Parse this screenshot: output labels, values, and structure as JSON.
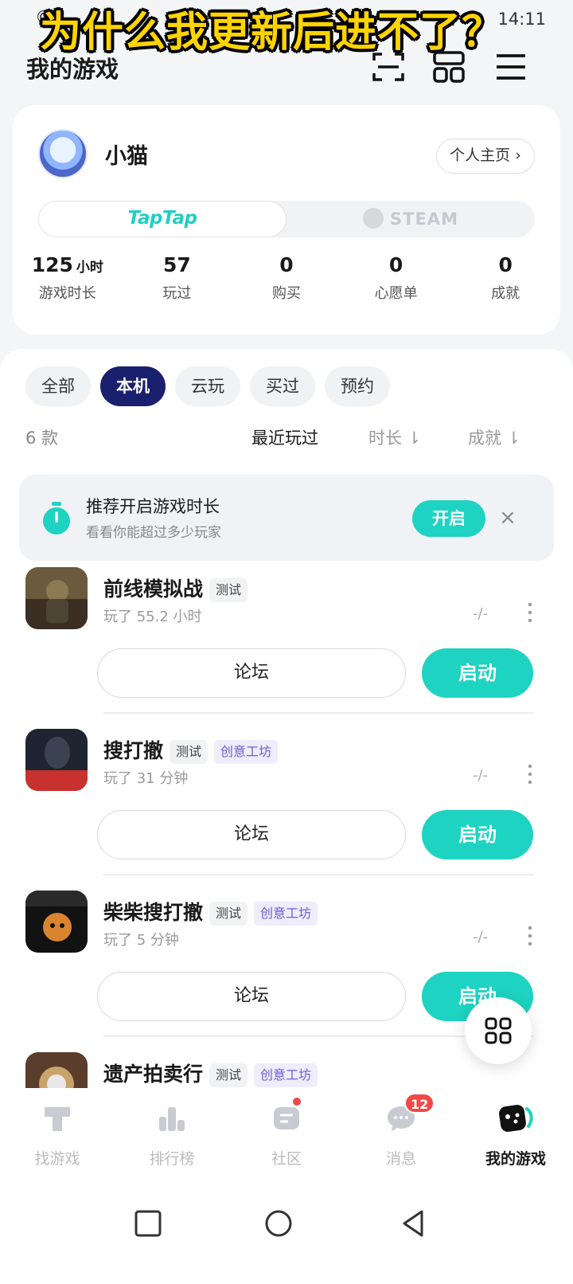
{
  "status_bar": {
    "left_icon": "©",
    "time": "14:11",
    "icons": "▮ ◢"
  },
  "overlay_caption": "为什么我更新后进不了？",
  "header": {
    "title": "我的游戏",
    "icons": [
      "scan-icon",
      "grid-icon",
      "menu-icon"
    ]
  },
  "profile": {
    "username": "小猫",
    "profile_button": "个人主页 ›",
    "platforms": {
      "active": "TapTap",
      "inactive": "STEAM"
    },
    "stats": [
      {
        "value": "125",
        "unit": "小时",
        "label": "游戏时长"
      },
      {
        "value": "57",
        "unit": "",
        "label": "玩过"
      },
      {
        "value": "0",
        "unit": "",
        "label": "购买"
      },
      {
        "value": "0",
        "unit": "",
        "label": "心愿单"
      },
      {
        "value": "0",
        "unit": "",
        "label": "成就"
      }
    ]
  },
  "filters": {
    "tabs": [
      "全部",
      "本机",
      "云玩",
      "买过",
      "预约"
    ],
    "active_tab": "本机",
    "count": "6 款",
    "sort": {
      "recent": "最近玩过",
      "duration": "时长 ⇂",
      "achievement": "成就 ⇂"
    }
  },
  "banner": {
    "title": "推荐开启游戏时长",
    "subtitle": "看看你能超过多少玩家",
    "button": "开启",
    "close": "×"
  },
  "games": [
    {
      "title": "前线模拟战",
      "tags": [
        "测试"
      ],
      "played": "玩了 55.2 小时",
      "achievement": "-/-",
      "forum": "论坛",
      "launch": "启动"
    },
    {
      "title": "搜打撤",
      "tags": [
        "测试",
        "创意工坊"
      ],
      "played": "玩了 31 分钟",
      "achievement": "-/-",
      "forum": "论坛",
      "launch": "启动"
    },
    {
      "title": "柴柴搜打撤",
      "tags": [
        "测试",
        "创意工坊"
      ],
      "played": "玩了 5 分钟",
      "achievement": "-/-",
      "forum": "论坛",
      "launch": "启动"
    },
    {
      "title": "遗产拍卖行",
      "tags": [
        "测试",
        "创意工坊"
      ],
      "played": "",
      "achievement": "",
      "forum": "",
      "launch": ""
    }
  ],
  "bottom_nav": [
    {
      "label": "找游戏",
      "icon": "find-games-icon"
    },
    {
      "label": "排行榜",
      "icon": "ranking-icon"
    },
    {
      "label": "社区",
      "icon": "community-icon"
    },
    {
      "label": "消息",
      "icon": "message-icon",
      "badge": "12"
    },
    {
      "label": "我的游戏",
      "icon": "my-games-icon"
    }
  ],
  "colors": {
    "accent": "#1ed3c1",
    "active_tab": "#1a1f6e",
    "workshop_tag": "#6f5cd6",
    "badge": "#f24848"
  }
}
